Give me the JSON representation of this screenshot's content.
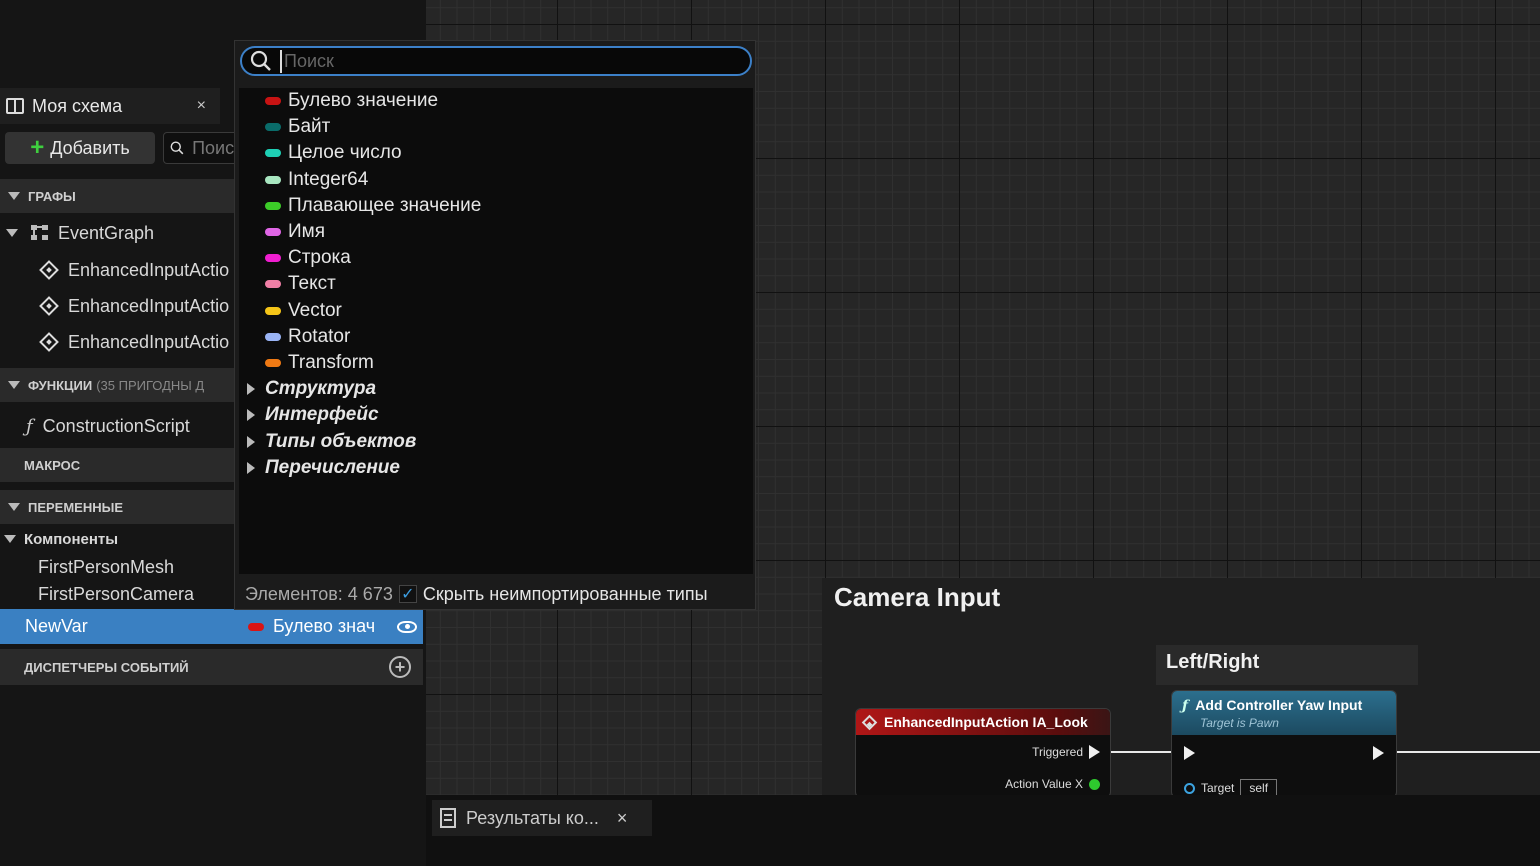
{
  "blueprint_panel": {
    "tab_title": "Моя схема",
    "tab_close": "×",
    "add_button": "Добавить",
    "search_placeholder": "Поиск",
    "sections": {
      "graphs": "ГРАФЫ",
      "functions": "ФУНКЦИИ",
      "functions_note": "(35 ПРИГОДНЫ Д",
      "macros": "МАКРОС",
      "variables": "ПЕРЕМЕННЫЕ",
      "dispatchers": "ДИСПЕТЧЕРЫ СОБЫТИЙ"
    },
    "graph_items": [
      "EventGraph",
      "EnhancedInputActio",
      "EnhancedInputActio",
      "EnhancedInputActio"
    ],
    "function_items": [
      "ConstructionScript"
    ],
    "components_label": "Компоненты",
    "component_items": [
      "FirstPersonMesh",
      "FirstPersonCamera"
    ],
    "selected_variable": {
      "name": "NewVar",
      "type": "Булево знач",
      "type_color": "#d91414"
    }
  },
  "type_dropdown": {
    "search_placeholder": "Поиск",
    "items": [
      {
        "label": "Булево значение",
        "color": "#c81313"
      },
      {
        "label": "Байт",
        "color": "#0a6c6a"
      },
      {
        "label": "Целое число",
        "color": "#1ed0b5"
      },
      {
        "label": "Integer64",
        "color": "#a8e6c0"
      },
      {
        "label": "Плавающее значение",
        "color": "#3ccc28"
      },
      {
        "label": "Имя",
        "color": "#e066e6"
      },
      {
        "label": "Строка",
        "color": "#f01ed0"
      },
      {
        "label": "Текст",
        "color": "#f07fa6"
      },
      {
        "label": "Vector",
        "color": "#f5c518"
      },
      {
        "label": "Rotator",
        "color": "#9ab4f5"
      },
      {
        "label": "Transform",
        "color": "#f07a14"
      }
    ],
    "categories": [
      "Структура",
      "Интерфейс",
      "Типы объектов",
      "Перечисление"
    ],
    "footer_count": "Элементов: 4 673",
    "footer_checkbox_label": "Скрыть неимпортированные типы",
    "footer_checkbox_checked": true
  },
  "graph": {
    "comment_title": "Camera Input",
    "sub_comment_title": "Left/Right",
    "event_node": {
      "title": "EnhancedInputAction IA_Look",
      "pin_triggered": "Triggered",
      "pin_value": "Action Value X"
    },
    "function_node": {
      "title": "Add Controller Yaw Input",
      "subtitle": "Target is Pawn",
      "pin_target": "Target",
      "target_default": "self"
    }
  },
  "bottom_tab": {
    "label": "Результаты ко...",
    "close": "×"
  }
}
